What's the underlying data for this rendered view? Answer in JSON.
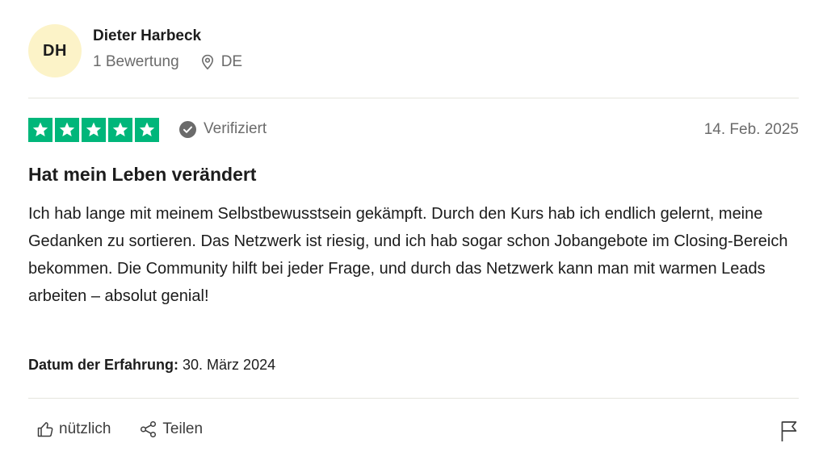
{
  "reviewer": {
    "initials": "DH",
    "name": "Dieter Harbeck",
    "reviews_count": "1 Bewertung",
    "country": "DE"
  },
  "review": {
    "rating": 5,
    "verified_label": "Verifiziert",
    "date": "14. Feb. 2025",
    "title": "Hat mein Leben verändert",
    "text": "Ich hab lange mit meinem Selbstbewusstsein gekämpft. Durch den Kurs hab ich endlich gelernt, meine Gedanken zu sortieren. Das Netzwerk ist riesig, und ich hab sogar schon Jobangebote im Closing-Bereich bekommen. Die Community hilft bei jeder Frage, und durch das Netzwerk kann man mit warmen Leads arbeiten – absolut genial!",
    "experience_label": "Datum der Erfahrung:",
    "experience_date": "30. März 2024"
  },
  "actions": {
    "useful_label": "nützlich",
    "share_label": "Teilen"
  },
  "colors": {
    "star_green": "#00b67a",
    "avatar_bg": "#fcf3c8"
  }
}
